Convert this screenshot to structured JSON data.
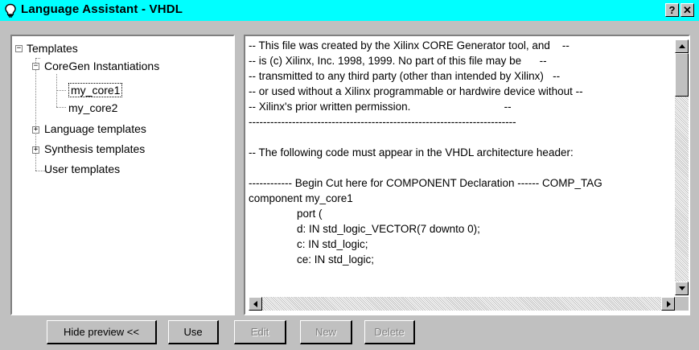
{
  "window": {
    "title": "Language Assistant - VHDL",
    "help_label": "?",
    "close_label": "✕"
  },
  "tree": {
    "root": "Templates",
    "coregen": "CoreGen Instantiations",
    "core1": "my_core1",
    "core2": "my_core2",
    "language": "Language templates",
    "synthesis": "Synthesis templates",
    "user": "User templates"
  },
  "preview": {
    "lines": [
      "-- This file was created by the Xilinx CORE Generator tool, and    --",
      "-- is (c) Xilinx, Inc. 1998, 1999. No part of this file may be      --",
      "-- transmitted to any third party (other than intended by Xilinx)   --",
      "-- or used without a Xilinx programmable or hardwire device without --",
      "-- Xilinx's prior written permission.                               --",
      "--------------------------------------------------------------------------",
      "",
      "-- The following code must appear in the VHDL architecture header:",
      "",
      "------------ Begin Cut here for COMPONENT Declaration ------ COMP_TAG",
      "component my_core1",
      "                port (",
      "                d: IN std_logic_VECTOR(7 downto 0);",
      "                c: IN std_logic;",
      "                ce: IN std_logic;"
    ]
  },
  "buttons": {
    "hide_preview": "Hide preview <<",
    "use": "Use",
    "edit": "Edit",
    "new": "New",
    "delete": "Delete"
  },
  "colors": {
    "titlebar": "#00ffff",
    "face": "#c0c0c0"
  },
  "icons": {
    "title": "lightbulb-icon"
  }
}
